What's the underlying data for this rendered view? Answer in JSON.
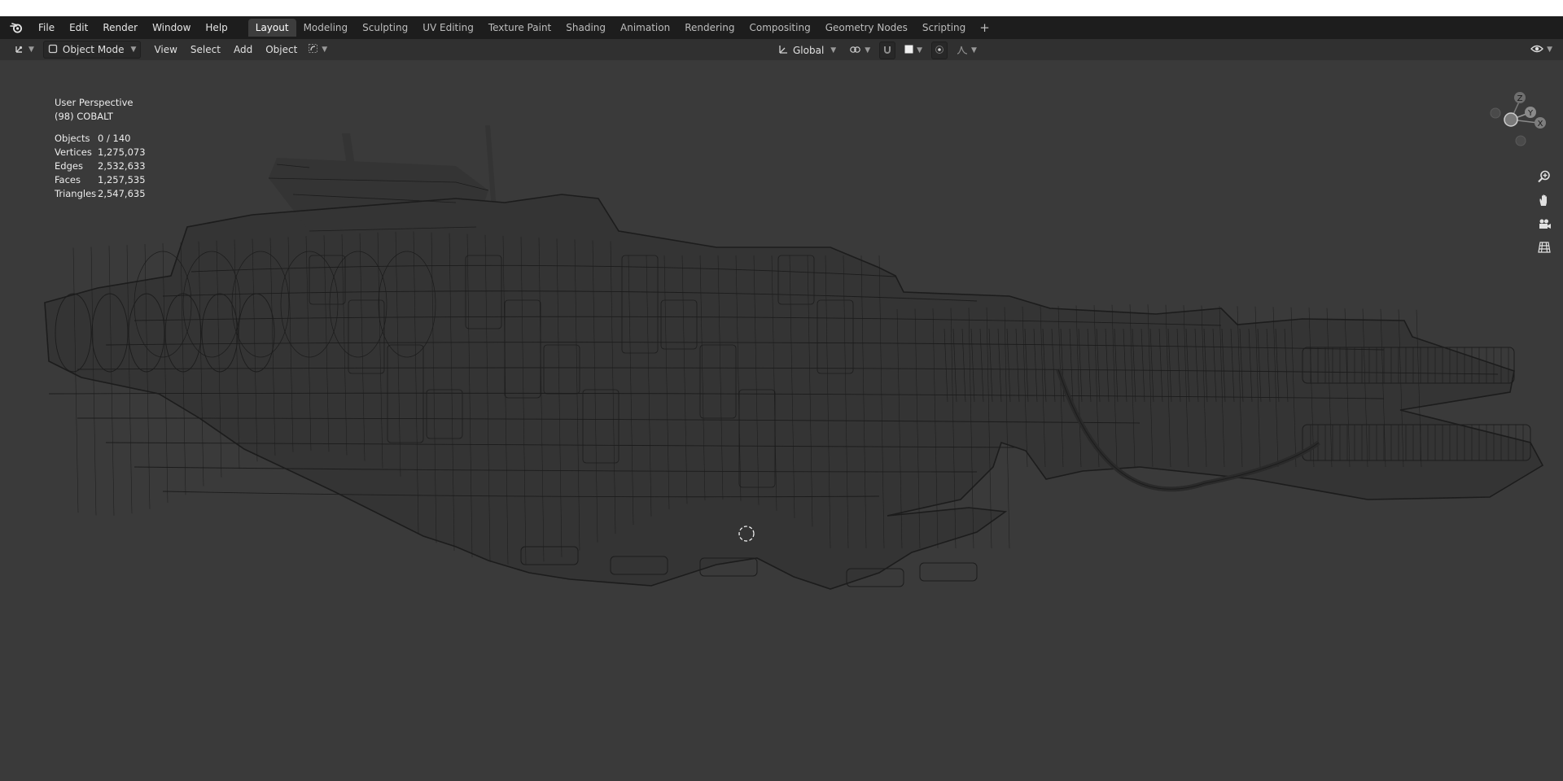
{
  "topbar": {
    "menu": [
      "File",
      "Edit",
      "Render",
      "Window",
      "Help"
    ],
    "workspaces": [
      {
        "label": "Layout",
        "active": true
      },
      {
        "label": "Modeling",
        "active": false
      },
      {
        "label": "Sculpting",
        "active": false
      },
      {
        "label": "UV Editing",
        "active": false
      },
      {
        "label": "Texture Paint",
        "active": false
      },
      {
        "label": "Shading",
        "active": false
      },
      {
        "label": "Animation",
        "active": false
      },
      {
        "label": "Rendering",
        "active": false
      },
      {
        "label": "Compositing",
        "active": false
      },
      {
        "label": "Geometry Nodes",
        "active": false
      },
      {
        "label": "Scripting",
        "active": false
      }
    ],
    "add_workspace": "+"
  },
  "header": {
    "mode": "Object Mode",
    "menus": [
      "View",
      "Select",
      "Add",
      "Object"
    ],
    "transform_orientation": "Global"
  },
  "viewport": {
    "perspective": "User Perspective",
    "collection": "(98) COBALT",
    "stats": [
      {
        "label": "Objects",
        "value": "0 / 140"
      },
      {
        "label": "Vertices",
        "value": "1,275,073"
      },
      {
        "label": "Edges",
        "value": "2,532,633"
      },
      {
        "label": "Faces",
        "value": "1,257,535"
      },
      {
        "label": "Triangles",
        "value": "2,547,635"
      }
    ],
    "gizmo_axes": {
      "z": "Z",
      "y": "Y",
      "x": "X"
    },
    "nav_icons": [
      "zoom-icon",
      "hand-pan-icon",
      "camera-icon",
      "grid-ortho-icon"
    ]
  },
  "colors": {
    "topbar_bg": "#1d1d1d",
    "header_bg": "#303030",
    "viewport_bg": "#3a3a3a",
    "wire": "#1c1c1c",
    "gizmo_x": "#8a8a8a",
    "gizmo_y": "#9a9a9a",
    "gizmo_z": "#7a7a7a"
  }
}
